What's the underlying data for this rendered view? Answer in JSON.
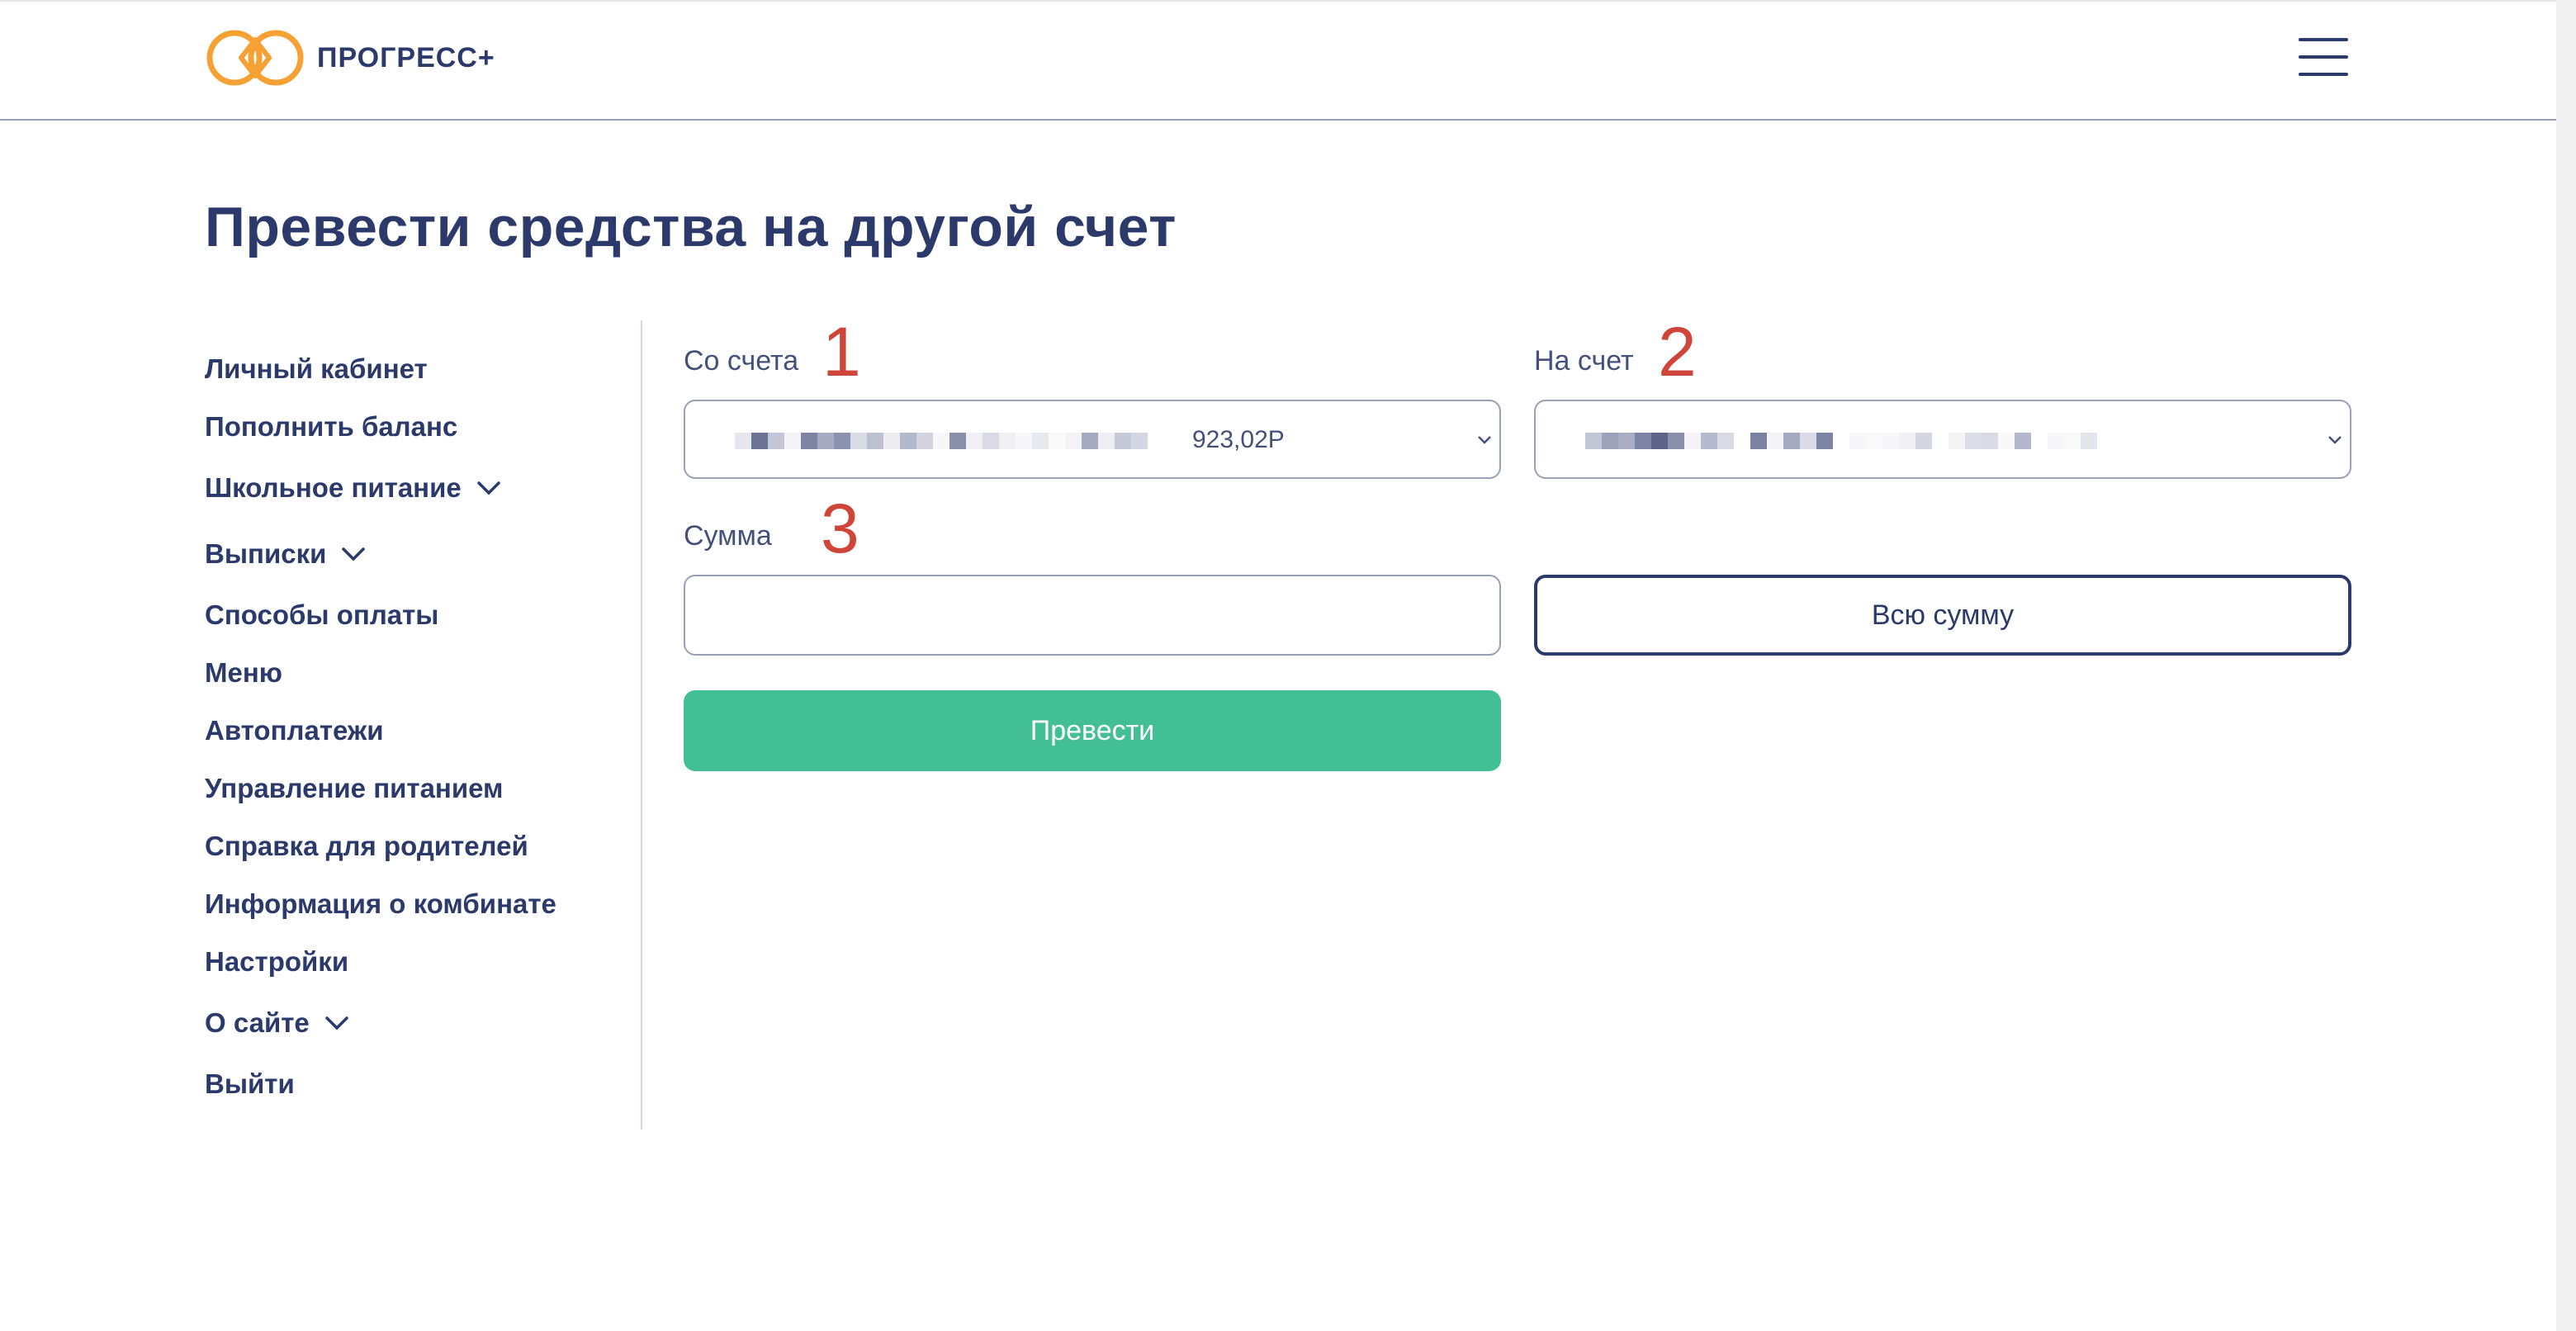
{
  "header": {
    "logo_text": "ПРОГРЕСС+",
    "menu_icon": "hamburger-menu-icon"
  },
  "page": {
    "title": "Превести средства на другой счет"
  },
  "sidebar": {
    "items": [
      {
        "label": "Личный кабинет",
        "has_dropdown": false
      },
      {
        "label": "Пополнить баланс",
        "has_dropdown": false
      },
      {
        "label": "Школьное питание",
        "has_dropdown": true
      },
      {
        "label": "Выписки",
        "has_dropdown": true
      },
      {
        "label": "Способы оплаты",
        "has_dropdown": false
      },
      {
        "label": "Меню",
        "has_dropdown": false
      },
      {
        "label": "Автоплатежи",
        "has_dropdown": false
      },
      {
        "label": "Управление питанием",
        "has_dropdown": false
      },
      {
        "label": "Справка для родителей",
        "has_dropdown": false
      },
      {
        "label": "Информация о комбинате",
        "has_dropdown": false
      },
      {
        "label": "Настройки",
        "has_dropdown": false
      },
      {
        "label": "О сайте",
        "has_dropdown": true
      },
      {
        "label": "Выйти",
        "has_dropdown": false
      }
    ]
  },
  "form": {
    "from_label": "Со счета",
    "from_marker": "1",
    "from_balance": "923,02Р",
    "to_label": "На счет",
    "to_marker": "2",
    "amount_label": "Сумма",
    "amount_marker": "3",
    "amount_value": "",
    "all_sum_button": "Всю сумму",
    "submit_button": "Превести"
  },
  "colors": {
    "primary": "#2b3a6b",
    "accent_orange": "#f5a134",
    "submit_green": "#43bf95",
    "marker_red": "#d0453a"
  }
}
